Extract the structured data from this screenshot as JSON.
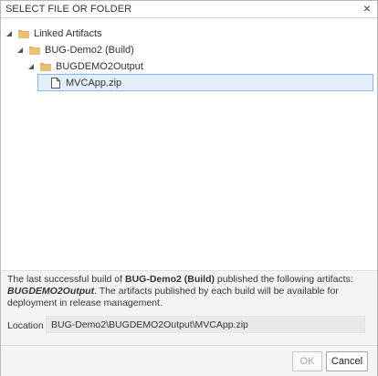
{
  "dialog": {
    "title": "SELECT FILE OR FOLDER",
    "close_glyph": "×"
  },
  "tree": {
    "root": {
      "label": "Linked Artifacts",
      "icon": "folder-icon",
      "expanded": true
    },
    "build": {
      "label": "BUG-Demo2 (Build)",
      "icon": "folder-icon",
      "expanded": true
    },
    "output": {
      "label": "BUGDEMO2Output",
      "icon": "folder-icon",
      "expanded": true
    },
    "file": {
      "label": "MVCApp.zip",
      "icon": "file-icon",
      "selected": true
    }
  },
  "info": {
    "prefix": "The last successful build of ",
    "build_name": "BUG-Demo2 (Build)",
    "middle": " published the following artifacts: ",
    "artifact_name": "BUGDEMO2Output",
    "suffix": ". The artifacts published by each build will be available for deployment in release management."
  },
  "location": {
    "label": "Location",
    "value": "BUG-Demo2\\BUGDEMO2Output\\MVCApp.zip"
  },
  "buttons": {
    "ok": "OK",
    "cancel": "Cancel",
    "ok_enabled": false
  },
  "colors": {
    "folder": "#dcb06a",
    "selection_bg": "#e4eefb",
    "selection_border": "#8fb3e4",
    "footer_bg": "#f4f4f4"
  }
}
